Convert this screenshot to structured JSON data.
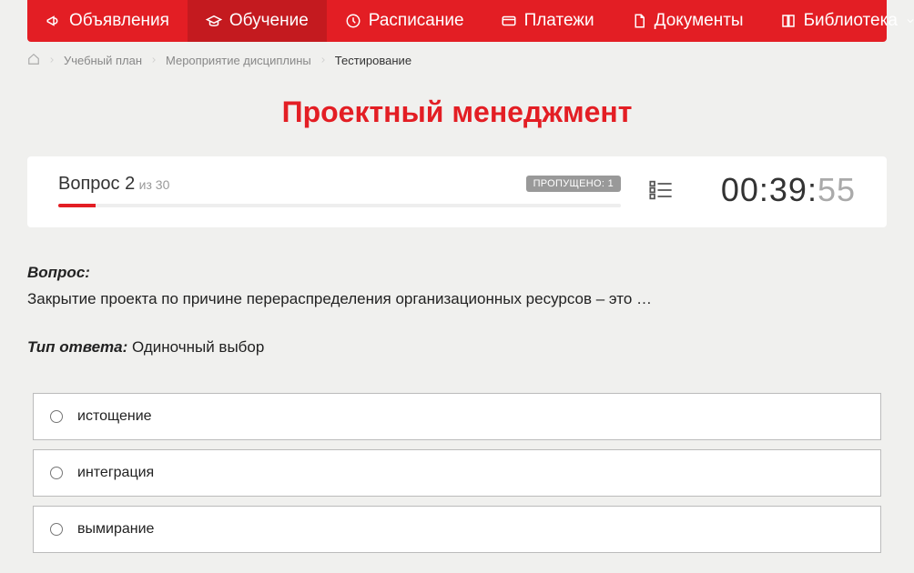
{
  "nav": [
    {
      "label": "Объявления",
      "icon": "megaphone-icon",
      "active": false
    },
    {
      "label": "Обучение",
      "icon": "graduation-icon",
      "active": true
    },
    {
      "label": "Расписание",
      "icon": "clock-icon",
      "active": false
    },
    {
      "label": "Платежи",
      "icon": "card-icon",
      "active": false
    },
    {
      "label": "Документы",
      "icon": "document-icon",
      "active": false
    },
    {
      "label": "Библиотека",
      "icon": "book-icon",
      "active": false,
      "has_dropdown": true
    }
  ],
  "breadcrumb": {
    "items": [
      "Учебный план",
      "Мероприятие дисциплины"
    ],
    "current": "Тестирование"
  },
  "page_title": "Проектный менеджмент",
  "question": {
    "number_label": "Вопрос 2",
    "total_label": "из 30",
    "skipped_badge": "ПРОПУЩЕНО: 1",
    "progress_percent": 6.67
  },
  "timer": {
    "main": "00:39:",
    "seconds": "55"
  },
  "question_body": {
    "label": "Вопрос:",
    "text": "Закрытие проекта по причине перераспределения организационных ресурсов – это …"
  },
  "answer_type": {
    "label": "Тип ответа:",
    "value": "Одиночный выбор"
  },
  "options": [
    "истощение",
    "интеграция",
    "вымирание"
  ]
}
